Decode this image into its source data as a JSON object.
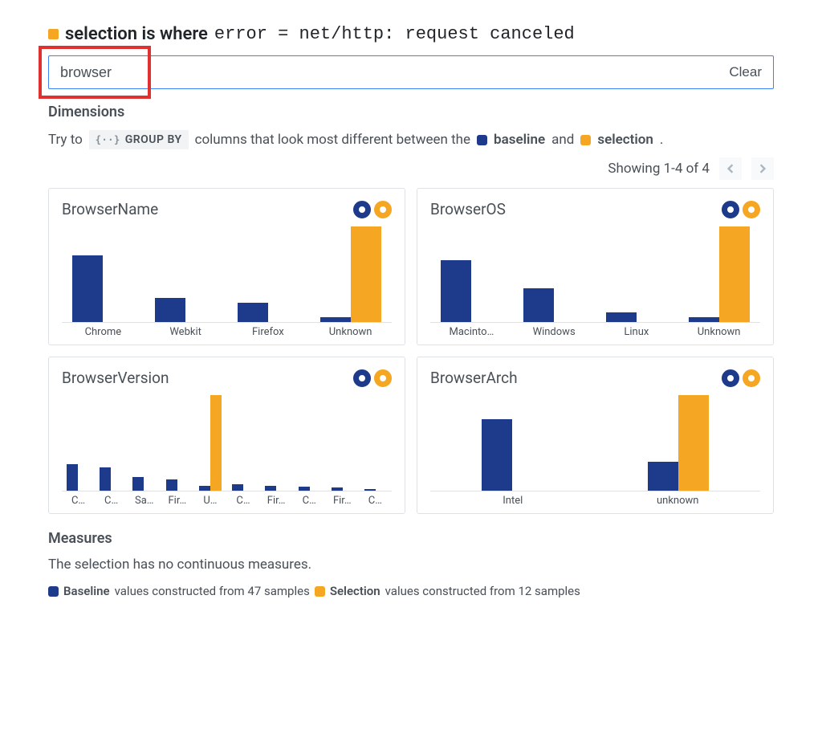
{
  "header": {
    "selection_label": "selection is where",
    "error_code": "error = net/http: request canceled"
  },
  "search": {
    "value": "browser",
    "clear_label": "Clear"
  },
  "dimensions": {
    "title": "Dimensions",
    "hint_pre": "Try to",
    "groupby_label": "GROUP BY",
    "hint_mid": "columns that look most different between the",
    "baseline_label": "baseline",
    "hint_and": "and",
    "selection_label": "selection",
    "hint_period": "."
  },
  "pager": {
    "status": "Showing 1-4 of 4"
  },
  "measures": {
    "title": "Measures",
    "text": "The selection has no continuous measures."
  },
  "footer": {
    "baseline_label": "Baseline",
    "baseline_text": "values constructed from 47 samples",
    "selection_label": "Selection",
    "selection_text": "values constructed from 12 samples"
  },
  "chart_data": [
    {
      "type": "bar",
      "title": "BrowserName",
      "ylim": [
        0,
        100
      ],
      "categories": [
        "Chrome",
        "Webkit",
        "Firefox",
        "Unknown"
      ],
      "series": [
        {
          "name": "baseline",
          "values": [
            70,
            25,
            20,
            5
          ]
        },
        {
          "name": "selection",
          "values": [
            0,
            0,
            0,
            100
          ]
        }
      ]
    },
    {
      "type": "bar",
      "title": "BrowserOS",
      "ylim": [
        0,
        100
      ],
      "categories": [
        "Macinto…",
        "Windows",
        "Linux",
        "Unknown"
      ],
      "series": [
        {
          "name": "baseline",
          "values": [
            65,
            35,
            10,
            5
          ]
        },
        {
          "name": "selection",
          "values": [
            0,
            0,
            0,
            100
          ]
        }
      ]
    },
    {
      "type": "bar",
      "title": "BrowserVersion",
      "ylim": [
        0,
        100
      ],
      "categories": [
        "C…",
        "C…",
        "Sa…",
        "Fir…",
        "U…",
        "C…",
        "Fir…",
        "C…",
        "Fir…",
        "C…"
      ],
      "series": [
        {
          "name": "baseline",
          "values": [
            28,
            24,
            14,
            12,
            5,
            7,
            5,
            4,
            3,
            2
          ]
        },
        {
          "name": "selection",
          "values": [
            0,
            0,
            0,
            0,
            100,
            0,
            0,
            0,
            0,
            0
          ]
        }
      ]
    },
    {
      "type": "bar",
      "title": "BrowserArch",
      "ylim": [
        0,
        100
      ],
      "categories": [
        "Intel",
        "unknown"
      ],
      "series": [
        {
          "name": "baseline",
          "values": [
            75,
            30
          ]
        },
        {
          "name": "selection",
          "values": [
            0,
            100
          ]
        }
      ]
    }
  ]
}
